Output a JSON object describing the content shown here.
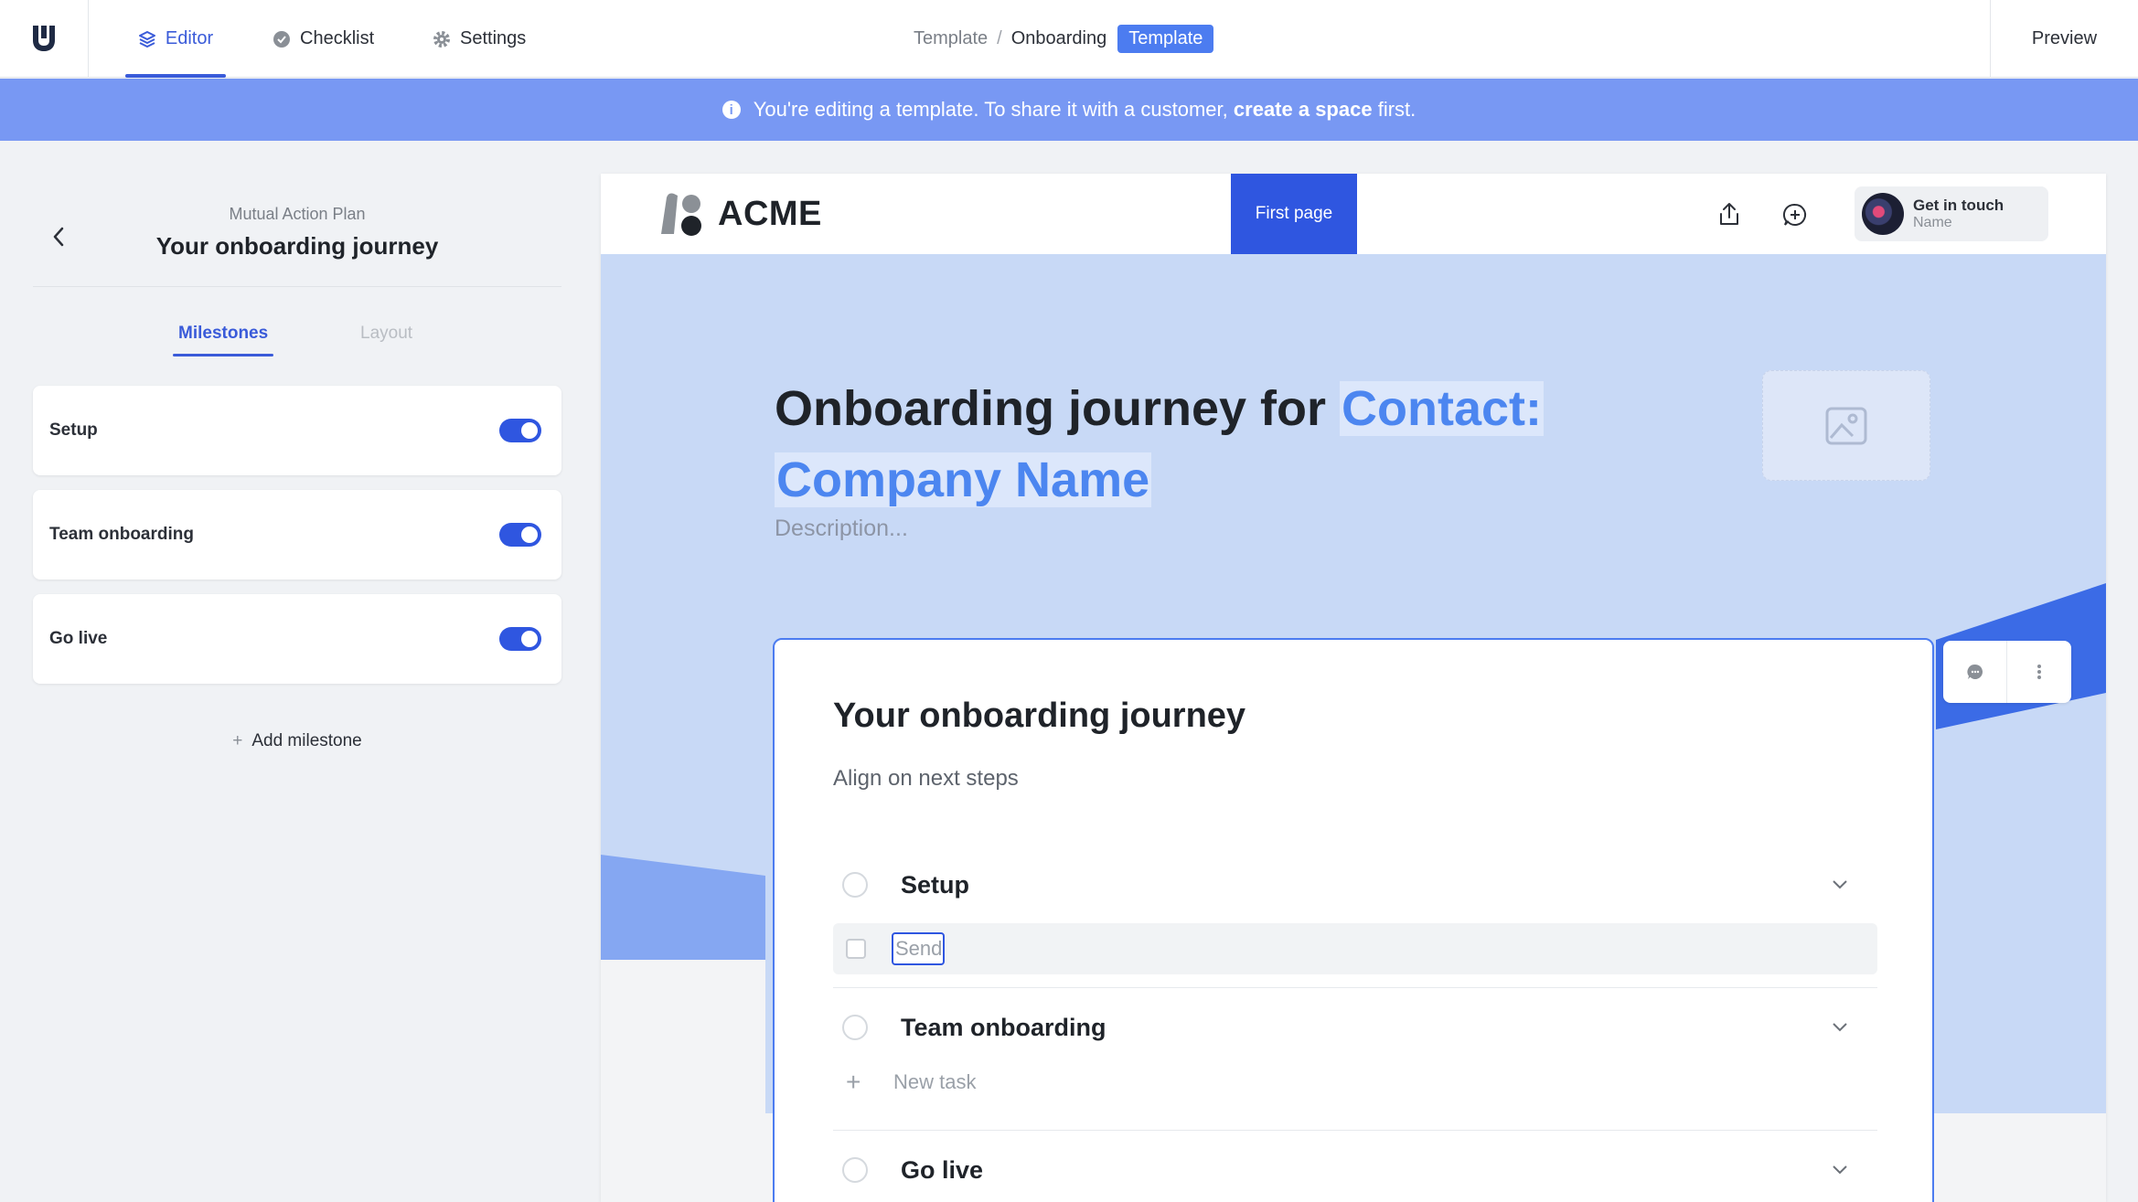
{
  "topbar": {
    "tabs": [
      {
        "label": "Editor",
        "icon": "layers-icon",
        "active": true
      },
      {
        "label": "Checklist",
        "icon": "check-circle-icon",
        "active": false
      },
      {
        "label": "Settings",
        "icon": "gear-icon",
        "active": false
      }
    ],
    "breadcrumb": {
      "root": "Template",
      "separator": "/",
      "current": "Onboarding",
      "badge": "Template"
    },
    "preview_label": "Preview"
  },
  "banner": {
    "text_before": "You're editing a template. To share it with a customer,",
    "link_text": "create a space",
    "text_after": "first."
  },
  "left_panel": {
    "subtitle": "Mutual Action Plan",
    "title": "Your onboarding journey",
    "tabs": [
      {
        "label": "Milestones",
        "active": true
      },
      {
        "label": "Layout",
        "active": false
      }
    ],
    "milestones": [
      {
        "label": "Setup",
        "enabled": true
      },
      {
        "label": "Team onboarding",
        "enabled": true
      },
      {
        "label": "Go live",
        "enabled": true
      }
    ],
    "add_milestone_label": "Add milestone"
  },
  "page": {
    "brand": "ACME",
    "nav_item": "First page",
    "contact": {
      "title": "Get in touch",
      "name": "Name"
    },
    "hero": {
      "title_prefix": "Onboarding journey for",
      "title_var_1": "Contact:",
      "title_var_2": "Company Name",
      "description_placeholder": "Description..."
    },
    "card": {
      "title": "Your onboarding journey",
      "subtitle": "Align on next steps",
      "milestones": [
        {
          "name": "Setup"
        },
        {
          "name": "Team onboarding"
        },
        {
          "name": "Go live"
        }
      ],
      "task_input_value": "Send",
      "new_task_label": "New task"
    }
  },
  "colors": {
    "accent": "#3a5bd9",
    "banner": "#7898f3",
    "hero_bg": "#c8d9f6",
    "highlight_text": "#4c86f0",
    "toggle_on": "#2f56e0"
  }
}
